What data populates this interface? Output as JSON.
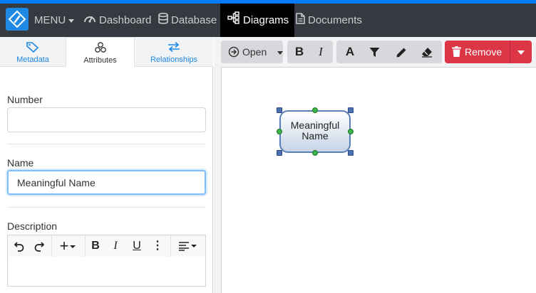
{
  "colors": {
    "accent": "#007bff",
    "nav_bg": "#343a40",
    "danger": "#dc3545",
    "tab_link": "#1e88e5"
  },
  "nav": {
    "menu_label": "MENU",
    "items": [
      {
        "label": "Dashboard",
        "icon": "gauge-icon"
      },
      {
        "label": "Database",
        "icon": "database-icon"
      },
      {
        "label": "Diagrams",
        "icon": "diagram-icon",
        "active": true
      },
      {
        "label": "Documents",
        "icon": "document-icon"
      }
    ]
  },
  "tabs": [
    {
      "label": "Metadata",
      "icon": "tag-icon"
    },
    {
      "label": "Attributes",
      "icon": "cubes-icon",
      "active": true
    },
    {
      "label": "Relationships",
      "icon": "arrows-exchange-icon"
    }
  ],
  "form": {
    "number_label": "Number",
    "number_value": "",
    "name_label": "Name",
    "name_value": "Meaningful Name",
    "description_label": "Description"
  },
  "editor_toolbar": [
    "undo-icon",
    "redo-icon",
    "insert-icon",
    "bold-icon",
    "italic-icon",
    "underline-icon",
    "more-icon",
    "align-icon"
  ],
  "toolbar": {
    "open_label": "Open",
    "remove_label": "Remove",
    "icons": [
      "bold-icon",
      "italic-icon",
      "font-color-icon",
      "filter-icon",
      "pencil-icon",
      "eraser-icon",
      "trash-icon"
    ]
  },
  "diagram": {
    "node_label_line1": "Meaningful",
    "node_label_line2": "Name"
  }
}
